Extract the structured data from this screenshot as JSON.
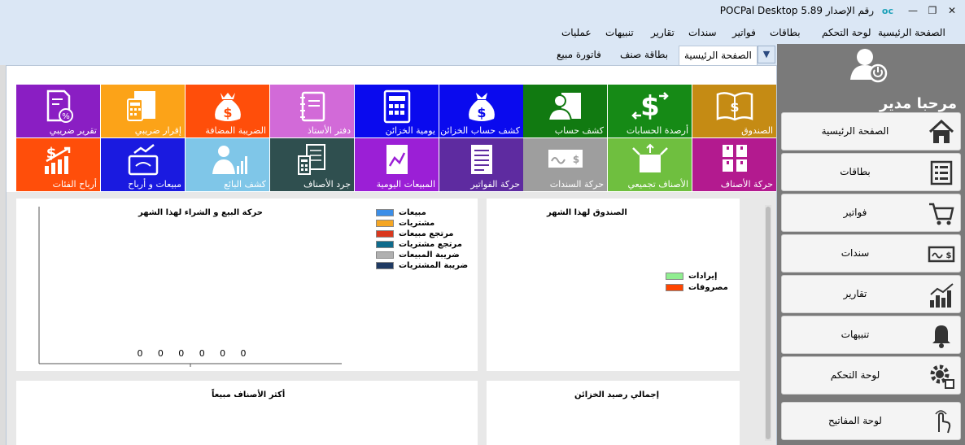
{
  "window": {
    "title": "POCPal Desktop  رقم الإصدار 5.89",
    "logo": "oc",
    "controls": [
      "minimize-icon",
      "restore-icon",
      "close-icon"
    ]
  },
  "menu": [
    "الصفحة الرئيسية",
    "لوحة التحكم",
    "بطاقات",
    "فواتير",
    "سندات",
    "تقارير",
    "تنبيهات",
    "عمليات"
  ],
  "tabs": [
    {
      "label": "الصفحة الرئيسية",
      "active": true
    },
    {
      "label": "بطاقة صنف",
      "active": false
    },
    {
      "label": "فاتورة مبيع",
      "active": false
    }
  ],
  "tiles_row1": [
    {
      "label": "الصندوق",
      "color": "#c58b14",
      "icon": "book-icon"
    },
    {
      "label": "أرصدة الحسابات",
      "color": "#168a16",
      "icon": "dollar-exchange-icon"
    },
    {
      "label": "كشف حساب",
      "color": "#117a11",
      "icon": "person-document-icon"
    },
    {
      "label": "كشف حساب الخزائن",
      "color": "#0a0aee",
      "icon": "money-bag-icon"
    },
    {
      "label": "يومية الخزائن",
      "color": "#0a0aee",
      "icon": "calculator-icon"
    },
    {
      "label": "دفتر الأستاذ",
      "color": "#d26ad8",
      "icon": "notebook-icon"
    },
    {
      "label": "الضريبة المضافة",
      "color": "#ff4e0a",
      "icon": "money-bag-crown-icon"
    },
    {
      "label": "إقرار ضريبي",
      "color": "#fca318",
      "icon": "calculator-document-icon"
    },
    {
      "label": "تقرير ضريبي",
      "color": "#8a1ec3",
      "icon": "tax-report-icon"
    }
  ],
  "tiles_row2": [
    {
      "label": "حركة الأصناف",
      "color": "#b31a8f",
      "icon": "boxes-icon"
    },
    {
      "label": "الأصناف تجميعي",
      "color": "#6fbf3f",
      "icon": "open-box-icon"
    },
    {
      "label": "حركة السندات",
      "color": "#9e9e9e",
      "icon": "check-icon"
    },
    {
      "label": "حركة الفواتير",
      "color": "#5e2ba0",
      "icon": "invoice-icon"
    },
    {
      "label": "المبيعات اليومية",
      "color": "#9b1fd6",
      "icon": "line-chart-doc-icon"
    },
    {
      "label": "جرد الأصناف",
      "color": "#2f4f4f",
      "icon": "inventory-calculator-icon"
    },
    {
      "label": "كشف البائع",
      "color": "#7fc6e8",
      "icon": "seller-chart-icon"
    },
    {
      "label": "مبيعات و أرباح",
      "color": "#1a1ae0",
      "icon": "sales-profit-icon"
    },
    {
      "label": "أرباح الفئات",
      "color": "#ff4e0a",
      "icon": "category-profit-icon"
    }
  ],
  "panels": {
    "sales_chart": {
      "title": "حركة البيع و الشراء لهذا الشهر",
      "legend": [
        {
          "label": "مبيعات",
          "color": "#3b8ee8"
        },
        {
          "label": "مشتريات",
          "color": "#f5a623"
        },
        {
          "label": "مرتجع مبيعات",
          "color": "#d9381e"
        },
        {
          "label": "مرتجع مشتريات",
          "color": "#0e6b8c"
        },
        {
          "label": "ضريبة المبيعات",
          "color": "#b0b0b0"
        },
        {
          "label": "ضريبة المشتريات",
          "color": "#1f3a63"
        }
      ]
    },
    "cashbox_chart": {
      "title": "الصندوق لهذا الشهر",
      "legend": [
        {
          "label": "إيرادات",
          "color": "#90ee90"
        },
        {
          "label": "مصروفات",
          "color": "#ff4500"
        }
      ]
    },
    "top_items": {
      "title": "أكثر الأصناف مبيعاً"
    },
    "treasury_total": {
      "title": "إجمالي رصيد الخزائن"
    }
  },
  "chart_data": {
    "type": "bar",
    "title": "حركة البيع و الشراء لهذا الشهر",
    "series": [
      {
        "name": "مبيعات",
        "values": [
          0
        ]
      },
      {
        "name": "مشتريات",
        "values": [
          0
        ]
      },
      {
        "name": "مرتجع مبيعات",
        "values": [
          0
        ]
      },
      {
        "name": "مرتجع مشتريات",
        "values": [
          0
        ]
      },
      {
        "name": "ضريبة المبيعات",
        "values": [
          0
        ]
      },
      {
        "name": "ضريبة المشتريات",
        "values": [
          0
        ]
      }
    ],
    "data_labels": [
      "0",
      "0",
      "0",
      "0",
      "0",
      "0"
    ],
    "legend": "top-right",
    "grid": false
  },
  "sidebar": {
    "welcome": "مرحبا مدير",
    "avatar_icon": "user-power-icon",
    "items": [
      {
        "label": "الصفحة الرئيسية",
        "icon": "home-icon"
      },
      {
        "label": "بطاقات",
        "icon": "cards-list-icon"
      },
      {
        "label": "فواتير",
        "icon": "cart-icon"
      },
      {
        "label": "سندات",
        "icon": "check-icon"
      },
      {
        "label": "تقارير",
        "icon": "bar-chart-icon"
      },
      {
        "label": "تنبيهات",
        "icon": "bell-icon"
      },
      {
        "label": "لوحة التحكم",
        "icon": "gear-icon"
      },
      {
        "label": "لوحة المفاتيح",
        "icon": "touch-hand-icon"
      }
    ]
  }
}
